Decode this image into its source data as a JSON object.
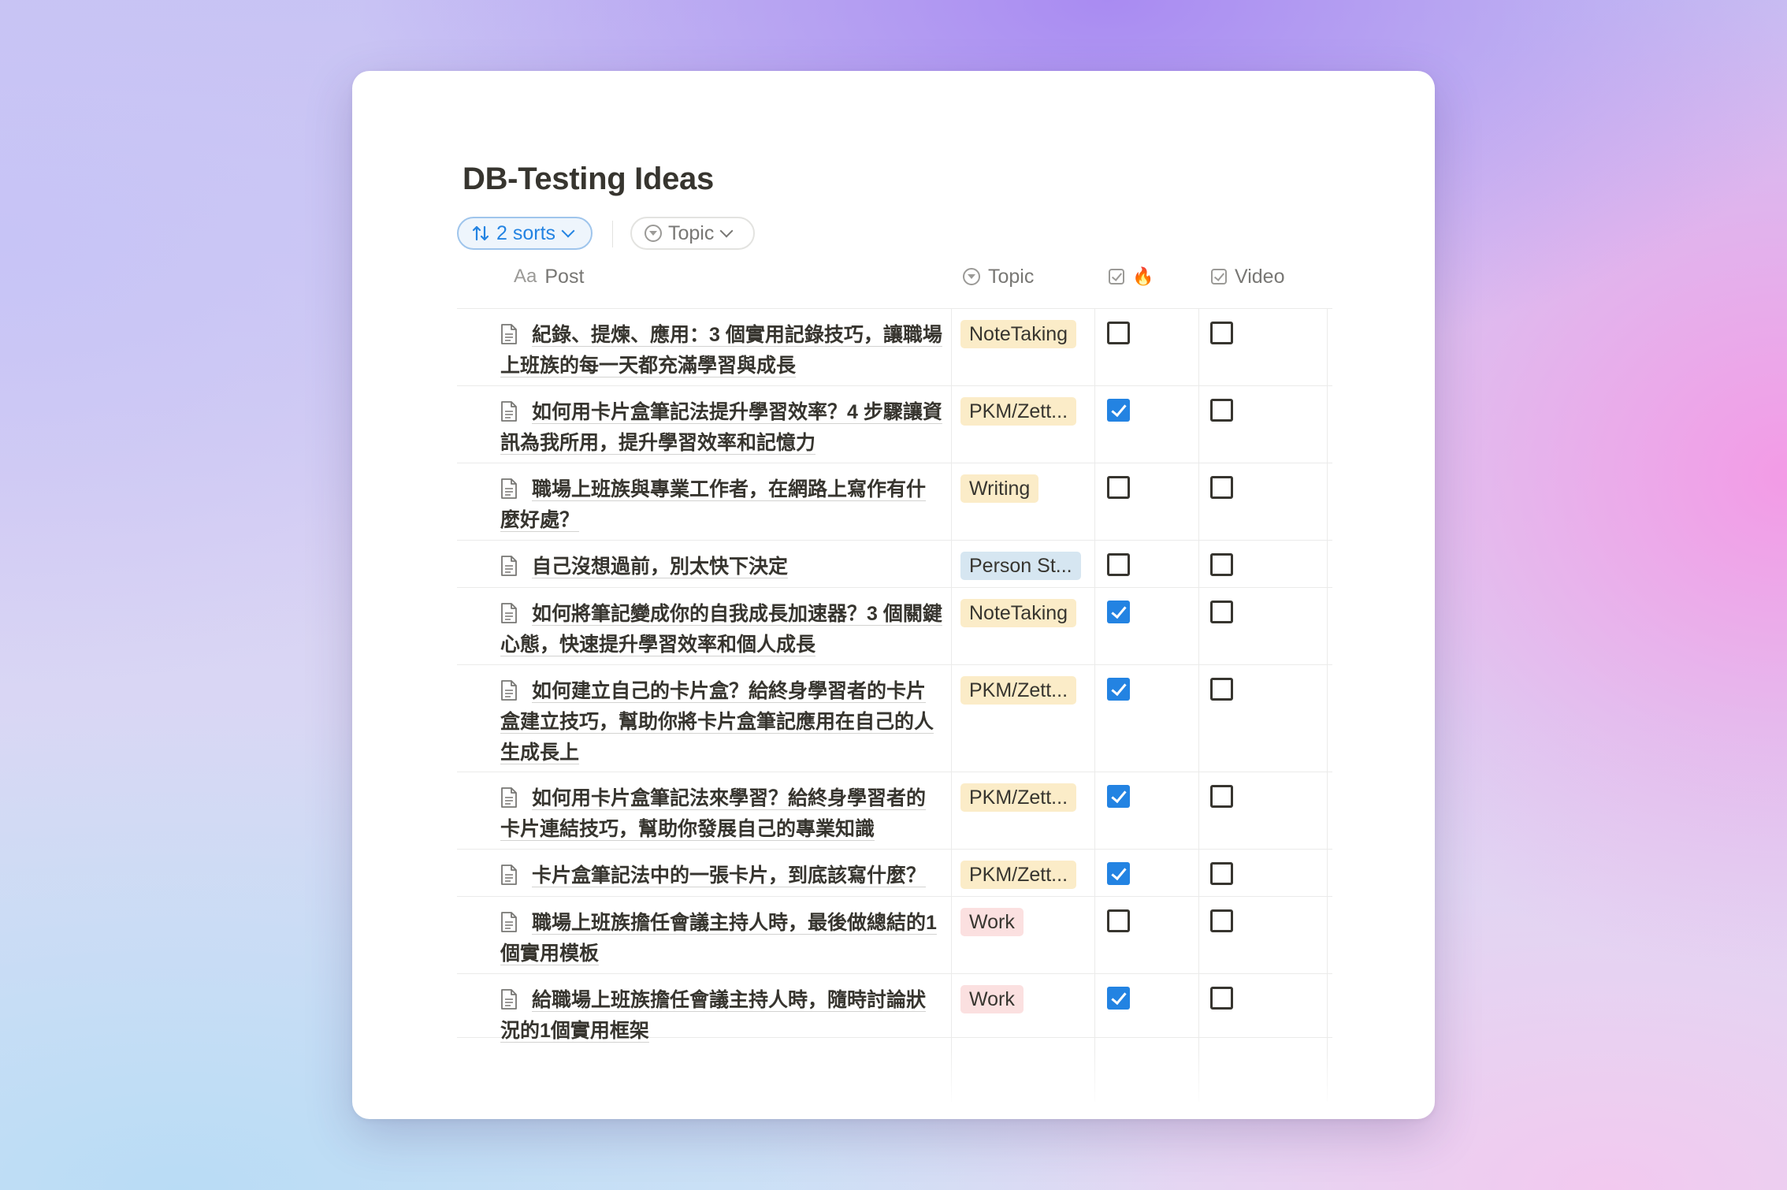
{
  "page": {
    "title": "DB-Testing Ideas"
  },
  "toolbar": {
    "sorts_label": "2 sorts",
    "topic_filter_label": "Topic"
  },
  "columns": {
    "post": {
      "prefix": "Aa",
      "label": "Post"
    },
    "topic": {
      "label": "Topic"
    },
    "hot": {
      "label": "🔥"
    },
    "video": {
      "label": "Video"
    }
  },
  "colors": {
    "accent": "#2383e2",
    "tag_yellow": "#fbecc8",
    "tag_blue": "#d6e6f1",
    "tag_red": "#fbe0e0"
  },
  "rows": [
    {
      "post": "紀錄、提煉、應用：3 個實用記錄技巧，讓職場上班族的每一天都充滿學習與成長",
      "topic": "NoteTaking",
      "topic_color": "yellow",
      "hot": false,
      "video": false
    },
    {
      "post": "如何用卡片盒筆記法提升學習效率？4 步驟讓資訊為我所用，提升學習效率和記憶力",
      "topic": "PKM/Zett...",
      "topic_color": "yellow",
      "hot": true,
      "video": false
    },
    {
      "post": "職場上班族與專業工作者，在網路上寫作有什麼好處？",
      "topic": "Writing",
      "topic_color": "yellow",
      "hot": false,
      "video": false
    },
    {
      "post": "自己沒想過前，別太快下決定",
      "topic": "Person St...",
      "topic_color": "blue",
      "hot": false,
      "video": false
    },
    {
      "post": "如何將筆記變成你的自我成長加速器？3 個關鍵心態，快速提升學習效率和個人成長",
      "topic": "NoteTaking",
      "topic_color": "yellow",
      "hot": true,
      "video": false
    },
    {
      "post": " 如何建立自己的卡片盒？給終身學習者的卡片盒建立技巧，幫助你將卡片盒筆記應用在自己的人生成長上",
      "topic": "PKM/Zett...",
      "topic_color": "yellow",
      "hot": true,
      "video": false
    },
    {
      "post": "如何用卡片盒筆記法來學習？給終身學習者的卡片連結技巧，幫助你發展自己的專業知識",
      "topic": "PKM/Zett...",
      "topic_color": "yellow",
      "hot": true,
      "video": false
    },
    {
      "post": "卡片盒筆記法中的一張卡片，到底該寫什麼？",
      "topic": "PKM/Zett...",
      "topic_color": "yellow",
      "hot": true,
      "video": false
    },
    {
      "post": "職場上班族擔任會議主持人時，最後做總結的1個實用模板",
      "topic": "Work",
      "topic_color": "red",
      "hot": false,
      "video": false
    },
    {
      "post": "給職場上班族擔任會議主持人時，隨時討論狀況的1個實用框架",
      "topic": "Work",
      "topic_color": "red",
      "hot": true,
      "video": false
    }
  ]
}
